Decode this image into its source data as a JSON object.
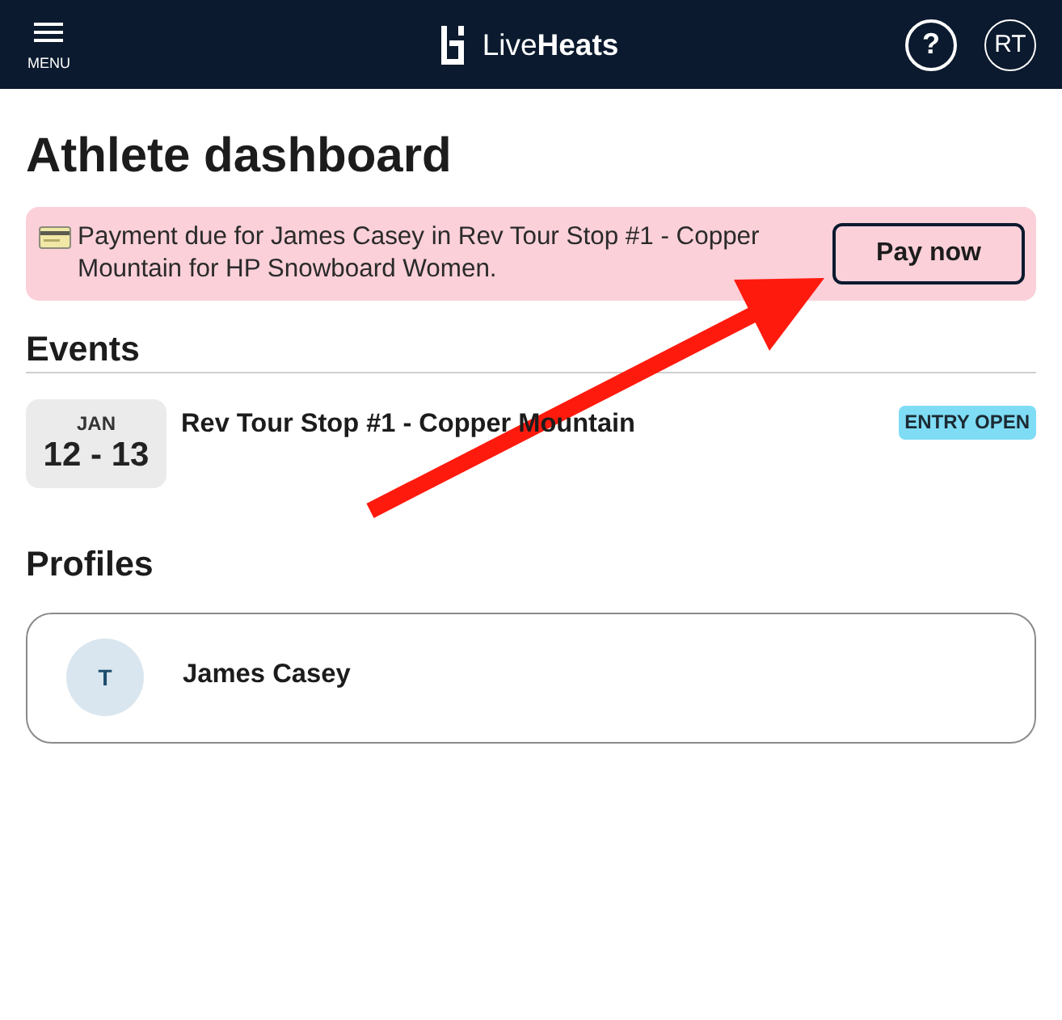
{
  "header": {
    "menu_label": "MENU",
    "logo_text": "Live**Heats**",
    "help_label": "?",
    "user_initials": "RT"
  },
  "title": "Athlete dashboard",
  "alert": {
    "message": "Payment due for James Casey in Rev Tour Stop #1 - Copper Mountain for HP Snowboard Women.",
    "button": "Pay now"
  },
  "events": {
    "heading": "Events",
    "items": [
      {
        "month": "JAN",
        "days": "12 - 13",
        "name": "Rev Tour Stop #1 - Copper Mountain",
        "status": "ENTRY OPEN"
      }
    ]
  },
  "profiles": {
    "heading": "Profiles",
    "items": [
      {
        "initial": "T",
        "name": "James Casey"
      }
    ]
  },
  "annotations": [
    {
      "kind": "arrow"
    }
  ]
}
